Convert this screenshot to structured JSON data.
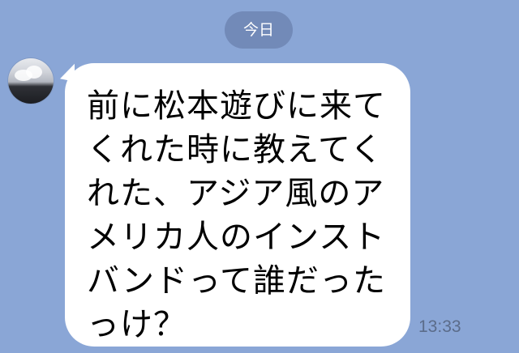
{
  "date_divider": {
    "label": "今日"
  },
  "message": {
    "sender_avatar_icon": "profile-photo-sky-icon",
    "text": "前に松本遊びに来て\nくれた時に教えてく\nれた、アジア風のア\nメリカ人のインスト\nバンドって誰だった\nっけ？",
    "time": "13:33"
  },
  "colors": {
    "background": "#8aa6d6",
    "bubble": "#ffffff",
    "timestamp": "#5b6c8a",
    "date_pill": "#6f86b8"
  }
}
